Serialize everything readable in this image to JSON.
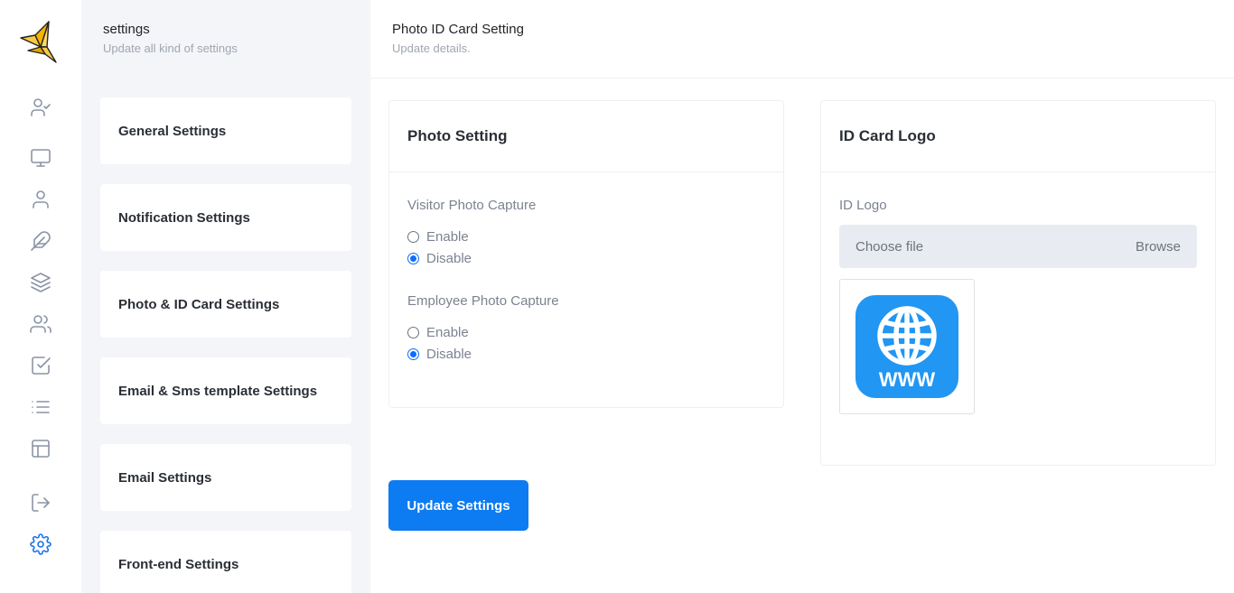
{
  "rail": {
    "items": [
      {
        "icon": "user-check-icon",
        "name": "rail-visitors"
      },
      {
        "icon": "monitor-icon",
        "name": "rail-dashboard"
      },
      {
        "icon": "user-icon",
        "name": "rail-users"
      },
      {
        "icon": "feather-icon",
        "name": "rail-designations"
      },
      {
        "icon": "layers-icon",
        "name": "rail-departments"
      },
      {
        "icon": "users-icon",
        "name": "rail-employees"
      },
      {
        "icon": "check-square-icon",
        "name": "rail-attendance"
      },
      {
        "icon": "list-icon",
        "name": "rail-reports"
      },
      {
        "icon": "layout-icon",
        "name": "rail-pages"
      },
      {
        "icon": "log-out-icon",
        "name": "rail-logout"
      },
      {
        "icon": "gear-icon",
        "name": "rail-settings"
      }
    ],
    "active_color": "#1a73e8",
    "icon_color": "#8a94a6"
  },
  "settings_panel": {
    "title": "settings",
    "subtitle": "Update all kind of settings",
    "items": [
      {
        "label": "General Settings"
      },
      {
        "label": "Notification Settings"
      },
      {
        "label": "Photo & ID Card Settings"
      },
      {
        "label": "Email & Sms template Settings"
      },
      {
        "label": "Email Settings"
      },
      {
        "label": "Front-end Settings"
      }
    ]
  },
  "main": {
    "title": "Photo ID Card Setting",
    "subtitle": "Update details."
  },
  "photo_setting": {
    "title": "Photo Setting",
    "visitor": {
      "label": "Visitor Photo Capture",
      "options": [
        "Enable",
        "Disable"
      ],
      "selected": "Disable"
    },
    "employee": {
      "label": "Employee Photo Capture",
      "options": [
        "Enable",
        "Disable"
      ],
      "selected": "Disable"
    }
  },
  "id_card_logo": {
    "title": "ID Card Logo",
    "field_label": "ID Logo",
    "file_placeholder": "Choose file",
    "browse_label": "Browse",
    "preview_text": "WWW",
    "preview_color": "#2196f3"
  },
  "actions": {
    "update_label": "Update Settings",
    "primary_color": "#0d7bf2"
  }
}
